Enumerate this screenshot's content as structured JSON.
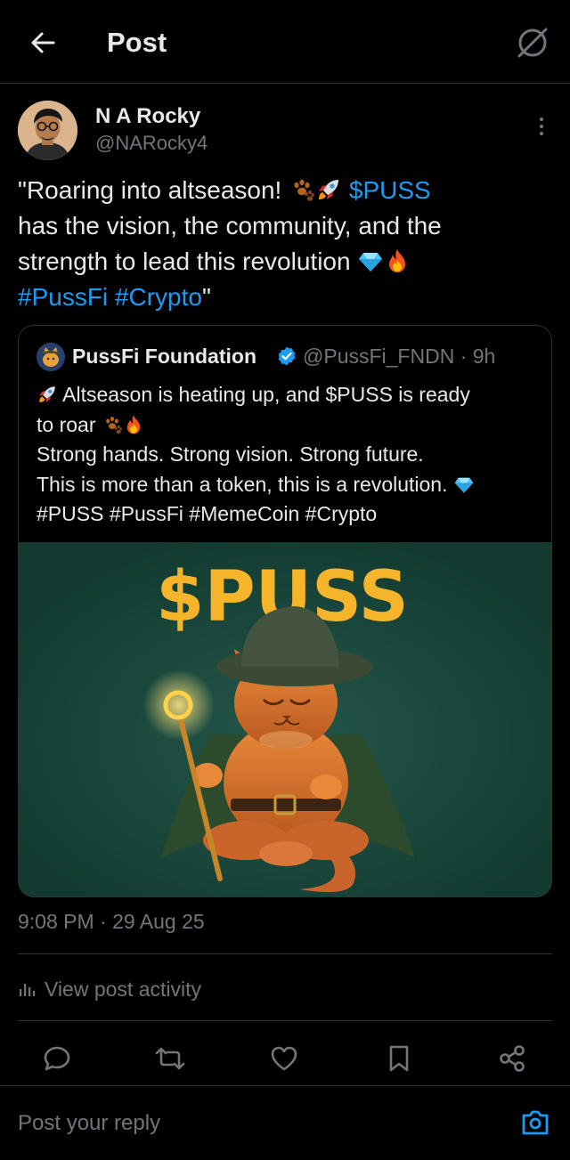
{
  "header": {
    "title": "Post"
  },
  "author": {
    "name": "N A Rocky",
    "handle": "@NARocky4"
  },
  "post": {
    "open_quote": "\"Roaring into altseason! ",
    "ticker": "$PUSS",
    "line2": "has the vision, the community, and the",
    "line3": "strength to lead this revolution ",
    "hashtag1": "#PussFi",
    "hashtag2": "#Crypto",
    "close_quote": "\""
  },
  "quoted_post": {
    "author_name": "PussFi Foundation",
    "handle_time": "@PussFi_FNDN · 9h",
    "line1": "Altseason is heating up, and $PUSS is ready",
    "line2": "to roar ",
    "line3": "Strong hands. Strong vision. Strong future.",
    "line4": "This is more than a token, this is a revolution. ",
    "line5": "#PUSS #PussFi #MemeCoin #Crypto",
    "image_title": "$PUSS"
  },
  "timestamp": "9:08 PM · 29 Aug 25",
  "activity": {
    "label": "View post activity"
  },
  "reply": {
    "placeholder": "Post your reply"
  },
  "colors": {
    "background": "#000000",
    "text": "#e7e9ea",
    "muted": "#71767b",
    "link": "#1d9bf0",
    "image_bg": "#163d33",
    "puss_gold": "#f5b42a"
  },
  "icons": {
    "back": "arrow-left-icon",
    "grok": "grok-icon",
    "more": "more-vertical-icon",
    "verified": "verified-badge-icon",
    "activity": "bar-chart-icon",
    "reply": "reply-icon",
    "repost": "repost-icon",
    "like": "heart-icon",
    "bookmark": "bookmark-icon",
    "share": "share-icon",
    "camera": "camera-icon"
  }
}
